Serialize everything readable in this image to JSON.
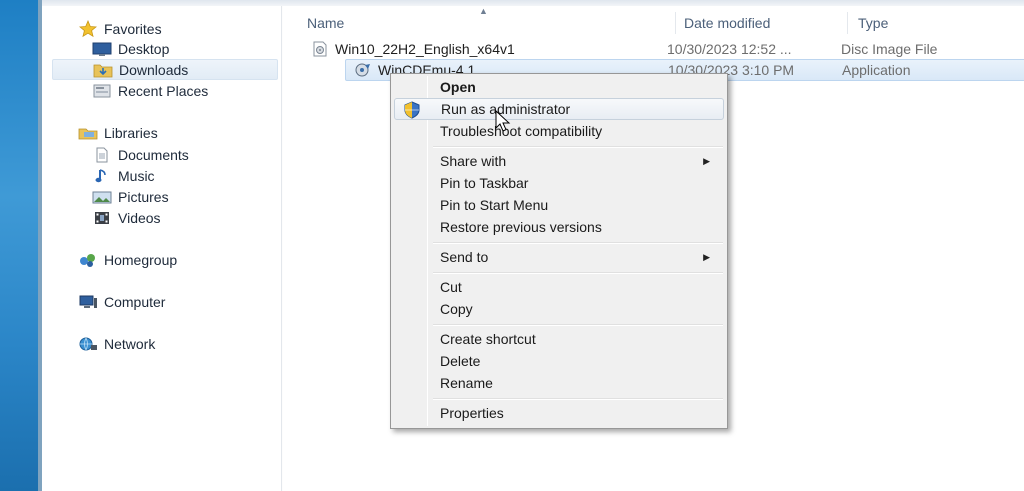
{
  "nav": {
    "favorites": "Favorites",
    "desktop": "Desktop",
    "downloads": "Downloads",
    "recent_places": "Recent Places",
    "libraries": "Libraries",
    "documents": "Documents",
    "music": "Music",
    "pictures": "Pictures",
    "videos": "Videos",
    "homegroup": "Homegroup",
    "computer": "Computer",
    "network": "Network"
  },
  "columns": {
    "name": "Name",
    "date_modified": "Date modified",
    "type": "Type"
  },
  "files": [
    {
      "name": "Win10_22H2_English_x64v1",
      "date": "10/30/2023 12:52 ...",
      "type": "Disc Image File"
    },
    {
      "name": "WinCDEmu-4.1",
      "date": "10/30/2023 3:10 PM",
      "type": "Application"
    }
  ],
  "context_menu": {
    "open": "Open",
    "run_as_admin": "Run as administrator",
    "troubleshoot": "Troubleshoot compatibility",
    "share_with": "Share with",
    "pin_taskbar": "Pin to Taskbar",
    "pin_start": "Pin to Start Menu",
    "restore_versions": "Restore previous versions",
    "send_to": "Send to",
    "cut": "Cut",
    "copy": "Copy",
    "create_shortcut": "Create shortcut",
    "delete": "Delete",
    "rename": "Rename",
    "properties": "Properties"
  },
  "icons": {
    "favorites": "star-icon",
    "desktop": "desktop-icon",
    "downloads": "folder-download-icon",
    "recent": "recent-places-icon",
    "libraries": "library-icon",
    "documents": "document-icon",
    "music": "music-note-icon",
    "pictures": "picture-icon",
    "videos": "film-icon",
    "homegroup": "homegroup-icon",
    "computer": "computer-icon",
    "network": "network-icon",
    "iso_file": "disc-image-icon",
    "app_file": "wincdemu-app-icon",
    "shield": "uac-shield-icon"
  },
  "colors": {
    "accent_blue": "#2b86c8",
    "selection": "#d9e8f7",
    "menu_bg": "#f0f0f0"
  }
}
